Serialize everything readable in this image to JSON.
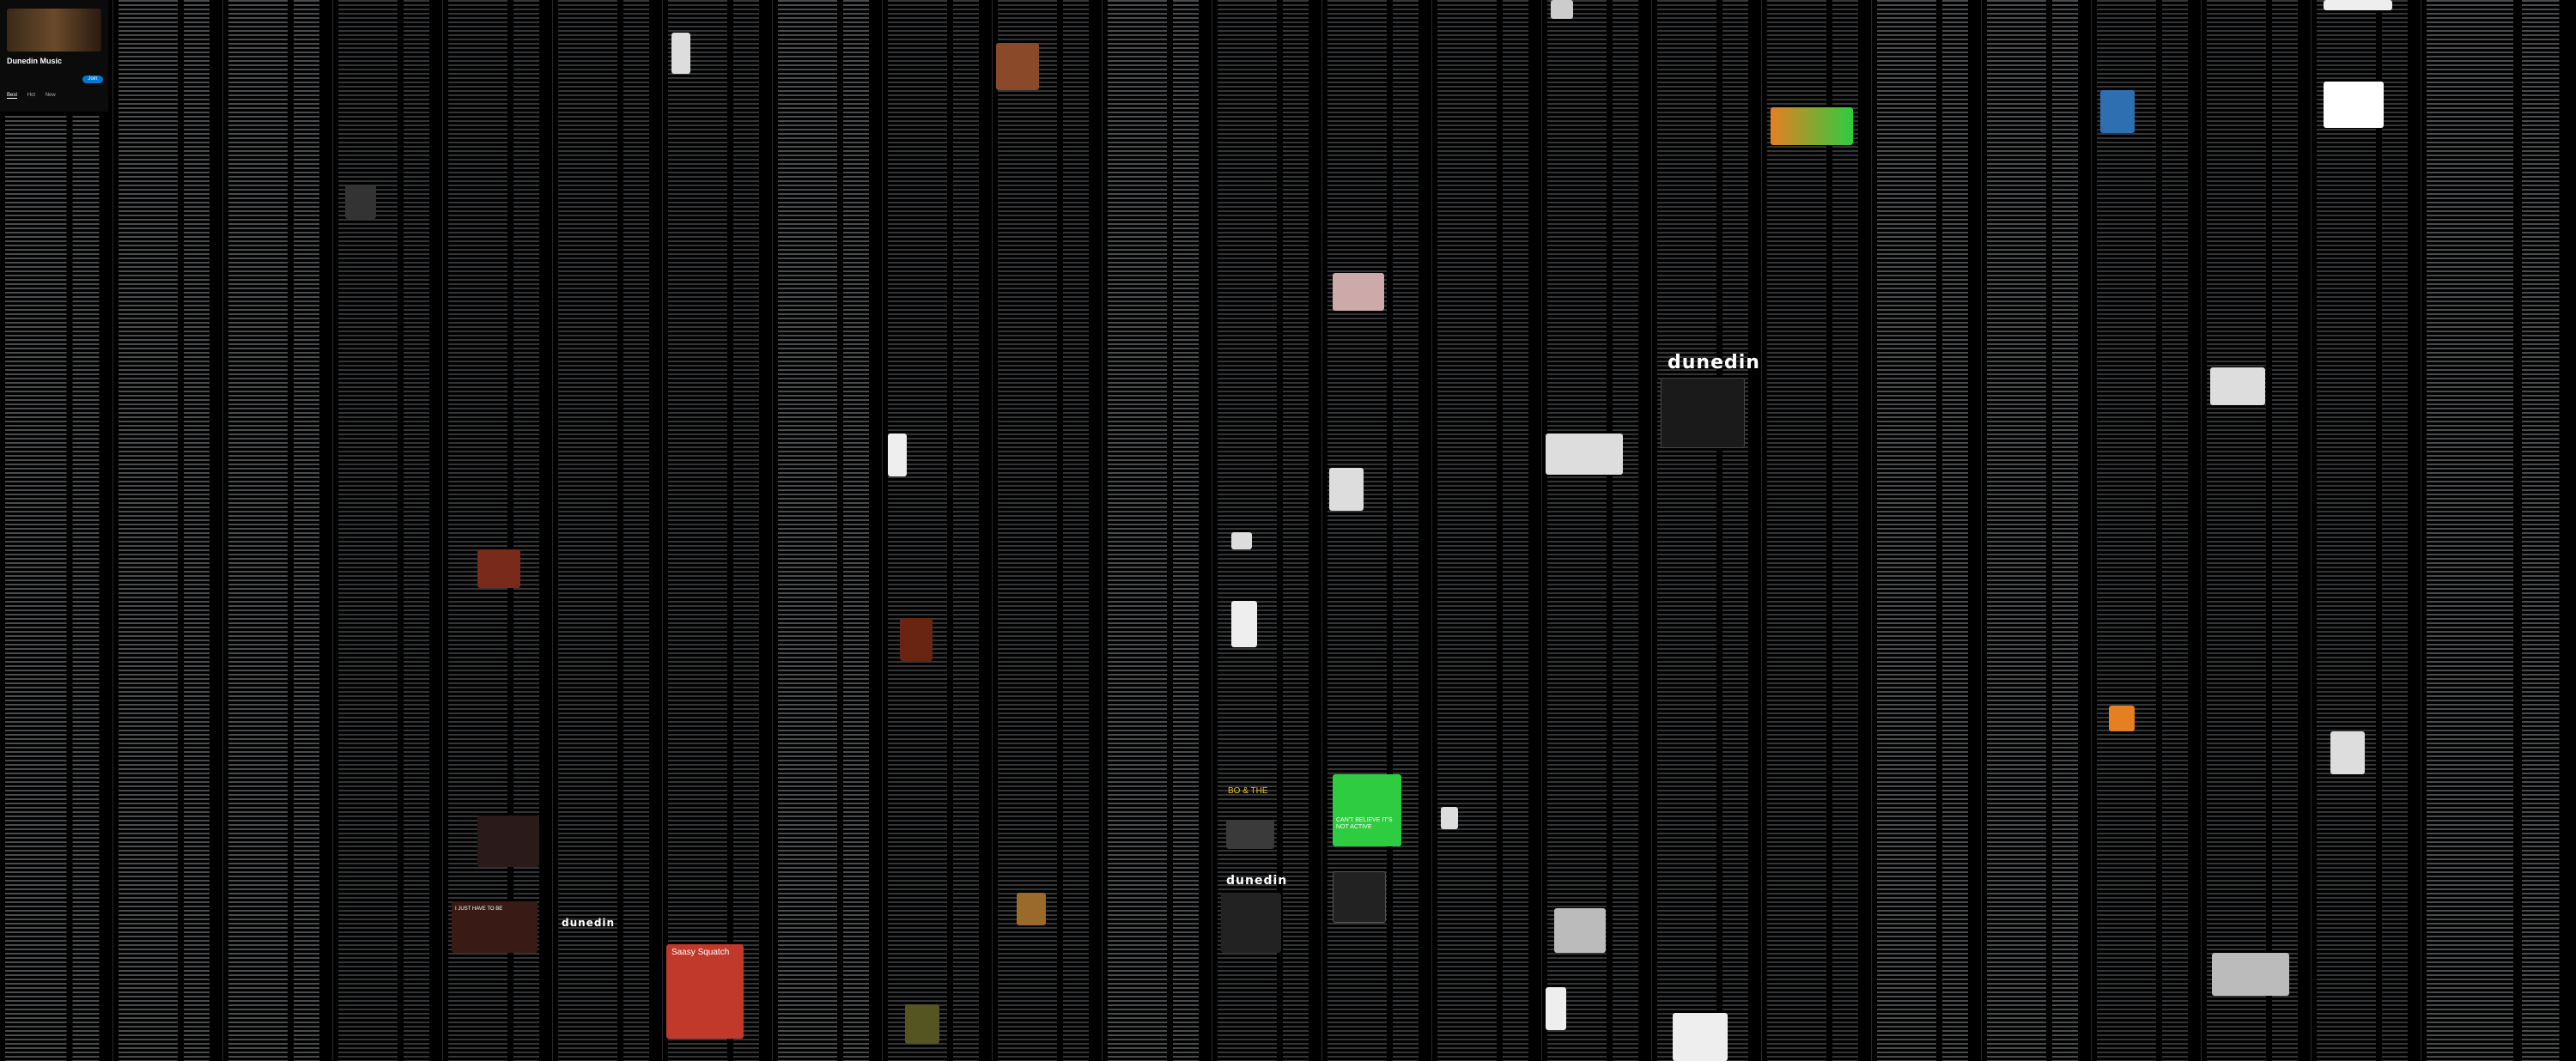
{
  "header": {
    "subreddit_name": "Dunedin Music",
    "join_label": "Join",
    "tabs": [
      "Best",
      "Hot",
      "New"
    ]
  },
  "posts": {
    "sassy_title": "Saasy Squatch",
    "logo_word": "dunedin",
    "dunedin_logo_big": "dunedin",
    "caption_green": "CAN'T BELIEVE IT'S NOT ACTIVE",
    "caption_bo": "BO & THE",
    "caption_band": "I JUST HAVE TO BE"
  },
  "colors": {
    "background": "#000000",
    "text": "#d7dadc",
    "accent": "#0079d3",
    "upvote": "#ff4500",
    "sassy_red": "#c0392b",
    "green_card": "#2ecc40"
  },
  "icons": [
    "subreddit-avatar-icon",
    "upvote-icon",
    "comment-icon"
  ]
}
